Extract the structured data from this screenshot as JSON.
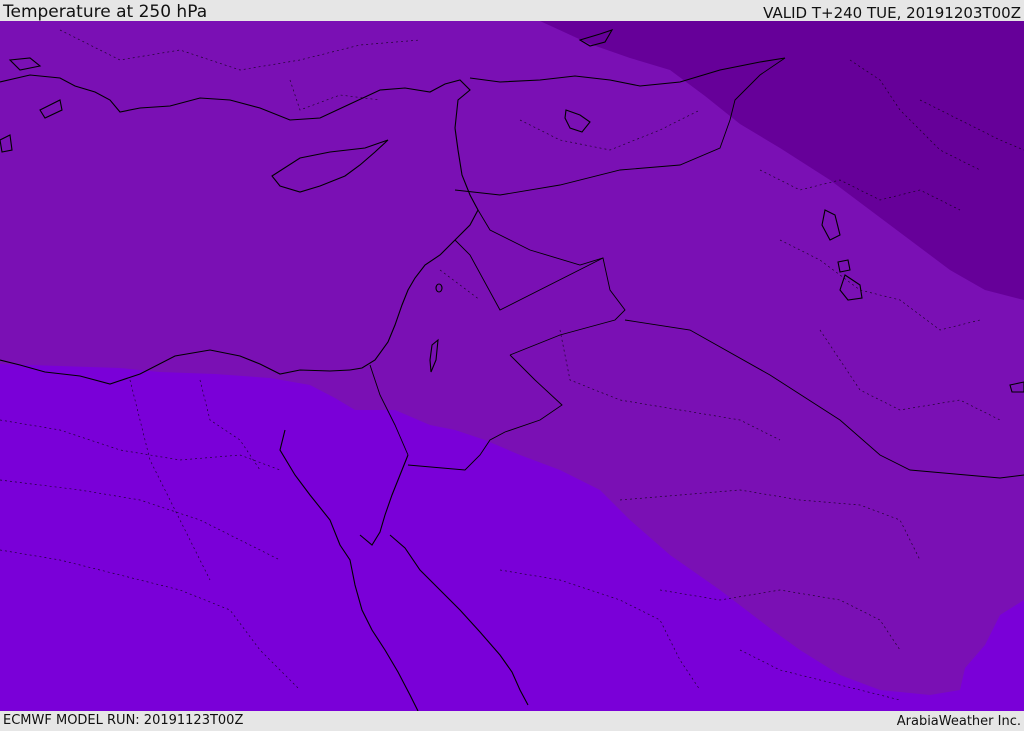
{
  "header": {
    "title": "Temperature at 250 hPa",
    "valid": "VALID T+240 TUE, 20191203T00Z"
  },
  "footer": {
    "model_run": "ECMWF MODEL RUN: 20191123T00Z",
    "credit": "ArabiaWeather Inc."
  },
  "map": {
    "region": "Eastern Mediterranean & Middle East",
    "colors": {
      "band_warm": "#7a00d8",
      "band_mid": "#7a10b4",
      "band_cold": "#660099",
      "coastline": "#000000",
      "borders": "#000000"
    }
  }
}
